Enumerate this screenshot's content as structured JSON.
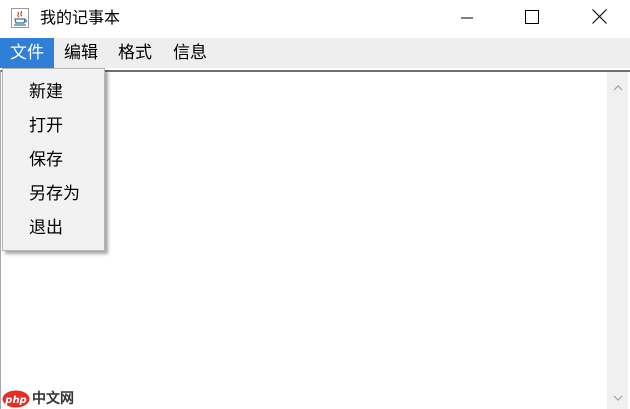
{
  "window": {
    "title": "我的记事本"
  },
  "title_controls": {
    "minimize_icon": "minimize-icon",
    "maximize_icon": "maximize-icon",
    "close_icon": "close-icon"
  },
  "menubar": {
    "items": [
      {
        "label": "文件",
        "active": true
      },
      {
        "label": "编辑"
      },
      {
        "label": "格式"
      },
      {
        "label": "信息"
      }
    ]
  },
  "file_menu": {
    "items": [
      {
        "label": "新建"
      },
      {
        "label": "打开"
      },
      {
        "label": "保存"
      },
      {
        "label": "另存为"
      },
      {
        "label": "退出"
      }
    ]
  },
  "editor": {
    "content": ""
  },
  "watermark": {
    "logo_text": "php",
    "text": "中文网"
  },
  "colors": {
    "menu_active_bg": "#2f7fd6",
    "menubar_bg": "#eeeeee",
    "dropdown_bg": "#f2f2f2",
    "watermark_red": "#e52d27"
  }
}
